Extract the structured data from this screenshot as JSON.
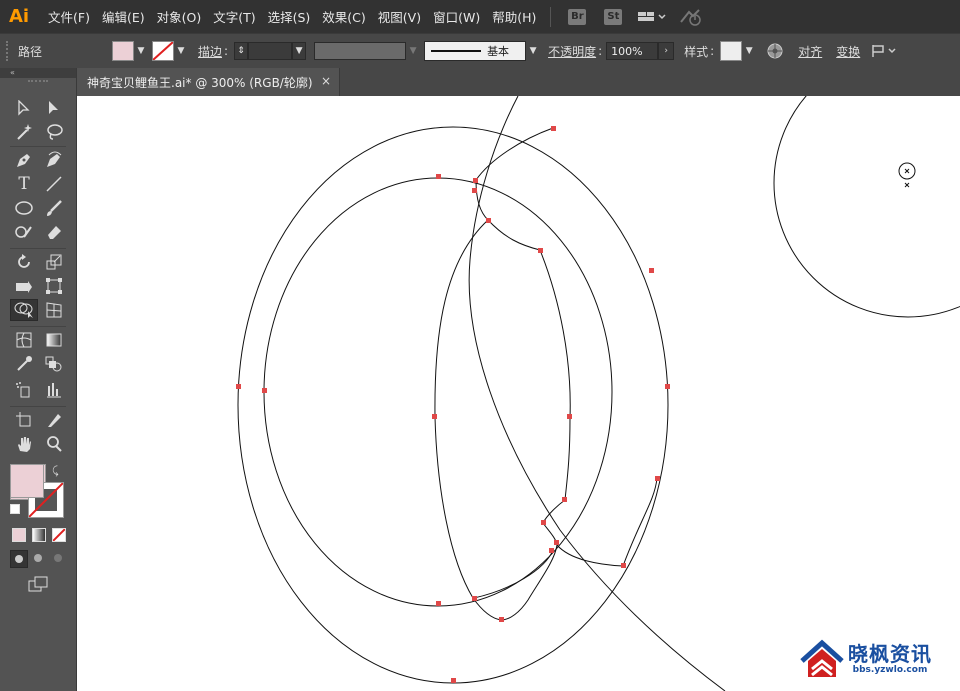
{
  "app": {
    "logo": "Ai"
  },
  "menu": [
    "文件(F)",
    "编辑(E)",
    "对象(O)",
    "文字(T)",
    "选择(S)",
    "效果(C)",
    "视图(V)",
    "窗口(W)",
    "帮助(H)"
  ],
  "app_buttons": {
    "bridge": "Br",
    "stock": "St"
  },
  "control_bar": {
    "selection_label": "路径",
    "fill_color": "#ecd0d6",
    "stroke_label": "描边",
    "stroke_profile": "基本",
    "opacity_label": "不透明度",
    "opacity_value": "100%",
    "style_label": "样式",
    "align_label": "对齐",
    "transform_label": "变换"
  },
  "document_tab": {
    "title": "神奇宝贝鲤鱼王.ai* @ 300% (RGB/轮廓)",
    "close": "×"
  },
  "tools": [
    "selection-tool",
    "direct-selection-tool",
    "magic-wand-tool",
    "lasso-tool",
    "pen-tool",
    "curvature-tool",
    "type-tool",
    "line-tool",
    "ellipse-tool",
    "paintbrush-tool",
    "shaper-tool",
    "eraser-tool",
    "rotate-tool",
    "scale-tool",
    "width-tool",
    "free-transform-tool",
    "shape-builder-tool",
    "perspective-grid-tool",
    "mesh-tool",
    "gradient-tool",
    "eyedropper-tool",
    "blend-tool",
    "symbol-sprayer-tool",
    "column-graph-tool",
    "artboard-tool",
    "slice-tool",
    "hand-tool",
    "zoom-tool"
  ],
  "colors": {
    "fill": "#ecd0d6",
    "accent": "#ff9a00",
    "anchor": "#e04848"
  },
  "watermark": {
    "title": "晓枫资讯",
    "url": "bbs.yzwlo.com"
  }
}
